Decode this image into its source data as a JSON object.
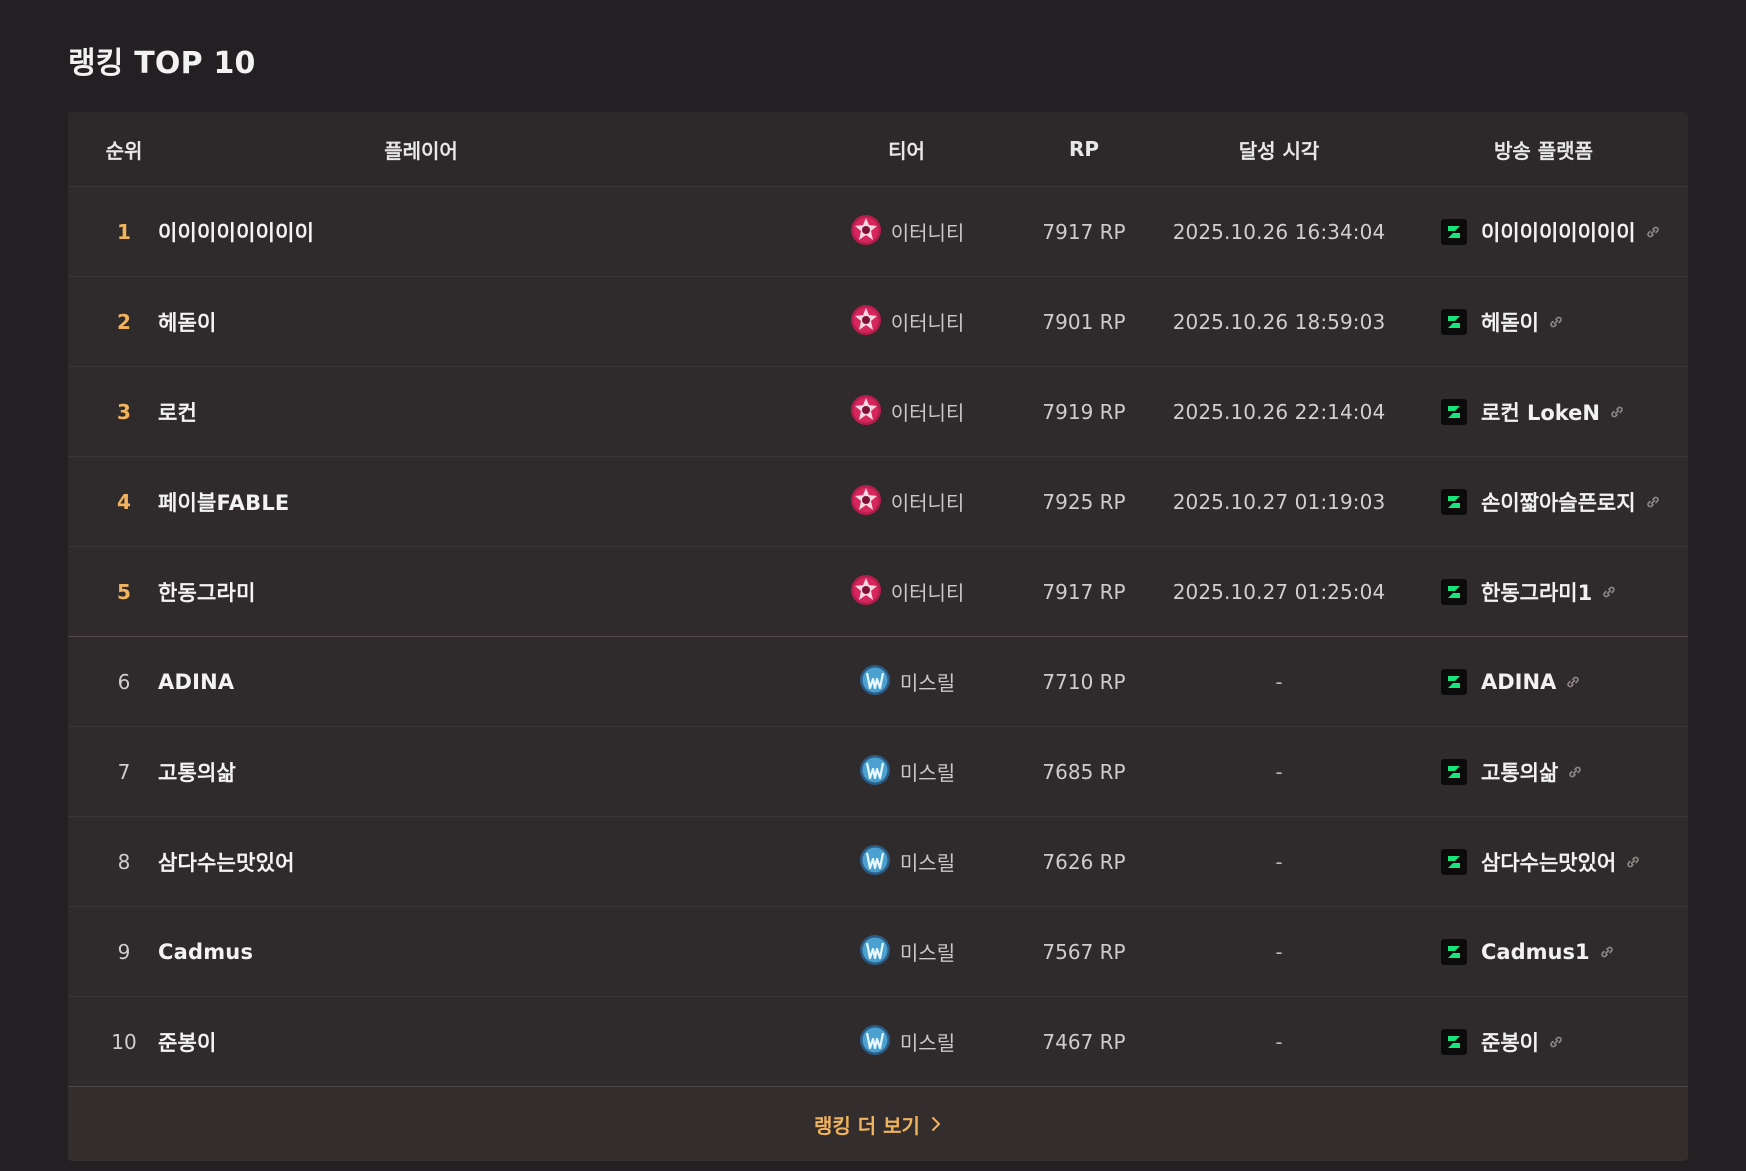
{
  "page": {
    "title": "랭킹 TOP 10"
  },
  "table": {
    "headers": {
      "rank": "순위",
      "player": "플레이어",
      "tier": "티어",
      "rp": "RP",
      "time": "달성 시각",
      "platform": "방송 플랫폼"
    },
    "rows": [
      {
        "rank": "1",
        "player": "이이이이이이이이",
        "tier": "이터니티",
        "rp": "7917 RP",
        "time": "2025.10.26 16:34:04",
        "channel": "이이이이이이이이"
      },
      {
        "rank": "2",
        "player": "헤돋이",
        "tier": "이터니티",
        "rp": "7901 RP",
        "time": "2025.10.26 18:59:03",
        "channel": "헤돋이"
      },
      {
        "rank": "3",
        "player": "로컨",
        "tier": "이터니티",
        "rp": "7919 RP",
        "time": "2025.10.26 22:14:04",
        "channel": "로컨 LokeN"
      },
      {
        "rank": "4",
        "player": "페이블FABLE",
        "tier": "이터니티",
        "rp": "7925 RP",
        "time": "2025.10.27 01:19:03",
        "channel": "손이짧아슬픈로지"
      },
      {
        "rank": "5",
        "player": "한동그라미",
        "tier": "이터니티",
        "rp": "7917 RP",
        "time": "2025.10.27 01:25:04",
        "channel": "한동그라미1"
      },
      {
        "rank": "6",
        "player": "ADINA",
        "tier": "미스릴",
        "rp": "7710 RP",
        "time": "-",
        "channel": "ADINA"
      },
      {
        "rank": "7",
        "player": "고통의삶",
        "tier": "미스릴",
        "rp": "7685 RP",
        "time": "-",
        "channel": "고통의삶"
      },
      {
        "rank": "8",
        "player": "삼다수는맛있어",
        "tier": "미스릴",
        "rp": "7626 RP",
        "time": "-",
        "channel": "삼다수는맛있어"
      },
      {
        "rank": "9",
        "player": "Cadmus",
        "tier": "미스릴",
        "rp": "7567 RP",
        "time": "-",
        "channel": "Cadmus1"
      },
      {
        "rank": "10",
        "player": "준봉이",
        "tier": "미스릴",
        "rp": "7467 RP",
        "time": "-",
        "channel": "준봉이"
      }
    ]
  },
  "footer": {
    "more_label": "랭킹 더 보기"
  },
  "icons": {
    "eternity": "eternity-tier-icon",
    "mithril": "mithril-tier-icon",
    "platform": "chzzk-icon",
    "link": "link-icon",
    "chevron": "chevron-right-icon"
  },
  "colors": {
    "background": "#231f23",
    "panel": "#2f2a2b",
    "accent": "#efb35e",
    "platform_green": "#17e47a"
  }
}
